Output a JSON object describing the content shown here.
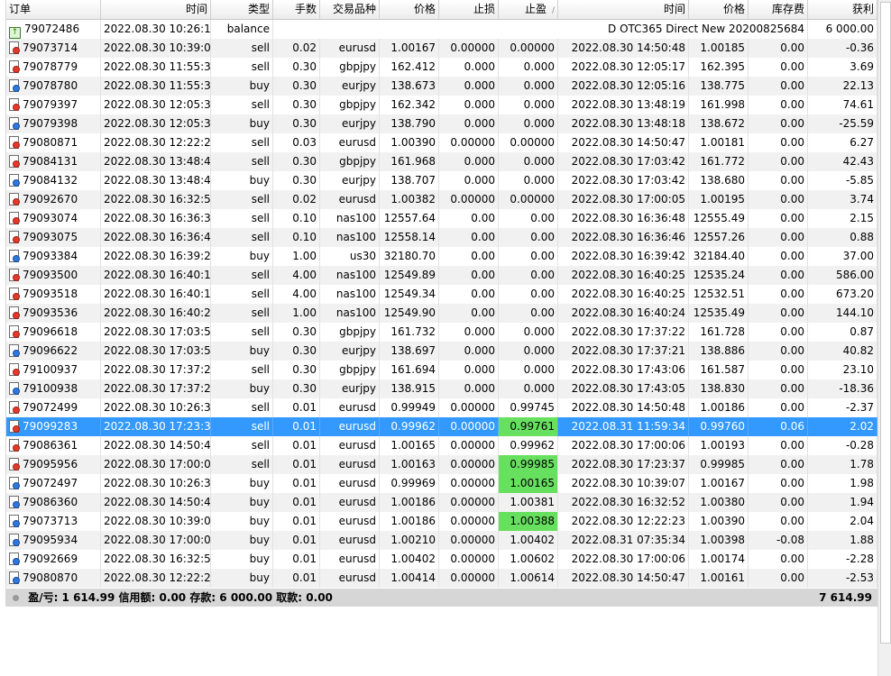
{
  "columns": [
    {
      "key": "order",
      "label": "订单",
      "align": "left"
    },
    {
      "key": "open_time",
      "label": "时间",
      "align": "right"
    },
    {
      "key": "type",
      "label": "类型",
      "align": "right"
    },
    {
      "key": "lots",
      "label": "手数",
      "align": "right"
    },
    {
      "key": "symbol",
      "label": "交易品种",
      "align": "right"
    },
    {
      "key": "open_price",
      "label": "价格",
      "align": "right"
    },
    {
      "key": "sl",
      "label": "止损",
      "align": "right"
    },
    {
      "key": "tp",
      "label": "止盈",
      "align": "right",
      "sort": "/"
    },
    {
      "key": "close_time",
      "label": "时间",
      "align": "right"
    },
    {
      "key": "close_price",
      "label": "价格",
      "align": "right"
    },
    {
      "key": "swap",
      "label": "库存费",
      "align": "right"
    },
    {
      "key": "profit",
      "label": "获利",
      "align": "right"
    }
  ],
  "balance_row": {
    "order": "79072486",
    "open_time": "2022.08.30 10:26:15",
    "type": "balance",
    "comment": "D OTC365 Direct New 20200825684",
    "profit": "6 000.00"
  },
  "rows": [
    {
      "order": "79073714",
      "open_time": "2022.08.30 10:39:08",
      "type": "sell",
      "lots": "0.02",
      "symbol": "eurusd",
      "open_price": "1.00167",
      "sl": "0.00000",
      "tp": "0.00000",
      "close_time": "2022.08.30 14:50:48",
      "close_price": "1.00185",
      "swap": "0.00",
      "profit": "-0.36"
    },
    {
      "order": "79078779",
      "open_time": "2022.08.30 11:55:37",
      "type": "sell",
      "lots": "0.30",
      "symbol": "gbpjpy",
      "open_price": "162.412",
      "sl": "0.000",
      "tp": "0.000",
      "close_time": "2022.08.30 12:05:17",
      "close_price": "162.395",
      "swap": "0.00",
      "profit": "3.69"
    },
    {
      "order": "79078780",
      "open_time": "2022.08.30 11:55:38",
      "type": "buy",
      "lots": "0.30",
      "symbol": "eurjpy",
      "open_price": "138.673",
      "sl": "0.000",
      "tp": "0.000",
      "close_time": "2022.08.30 12:05:16",
      "close_price": "138.775",
      "swap": "0.00",
      "profit": "22.13"
    },
    {
      "order": "79079397",
      "open_time": "2022.08.30 12:05:33",
      "type": "sell",
      "lots": "0.30",
      "symbol": "gbpjpy",
      "open_price": "162.342",
      "sl": "0.000",
      "tp": "0.000",
      "close_time": "2022.08.30 13:48:19",
      "close_price": "161.998",
      "swap": "0.00",
      "profit": "74.61"
    },
    {
      "order": "79079398",
      "open_time": "2022.08.30 12:05:33",
      "type": "buy",
      "lots": "0.30",
      "symbol": "eurjpy",
      "open_price": "138.790",
      "sl": "0.000",
      "tp": "0.000",
      "close_time": "2022.08.30 13:48:18",
      "close_price": "138.672",
      "swap": "0.00",
      "profit": "-25.59"
    },
    {
      "order": "79080871",
      "open_time": "2022.08.30 12:22:25",
      "type": "sell",
      "lots": "0.03",
      "symbol": "eurusd",
      "open_price": "1.00390",
      "sl": "0.00000",
      "tp": "0.00000",
      "close_time": "2022.08.30 14:50:47",
      "close_price": "1.00181",
      "swap": "0.00",
      "profit": "6.27"
    },
    {
      "order": "79084131",
      "open_time": "2022.08.30 13:48:41",
      "type": "sell",
      "lots": "0.30",
      "symbol": "gbpjpy",
      "open_price": "161.968",
      "sl": "0.000",
      "tp": "0.000",
      "close_time": "2022.08.30 17:03:42",
      "close_price": "161.772",
      "swap": "0.00",
      "profit": "42.43"
    },
    {
      "order": "79084132",
      "open_time": "2022.08.30 13:48:41",
      "type": "buy",
      "lots": "0.30",
      "symbol": "eurjpy",
      "open_price": "138.707",
      "sl": "0.000",
      "tp": "0.000",
      "close_time": "2022.08.30 17:03:42",
      "close_price": "138.680",
      "swap": "0.00",
      "profit": "-5.85"
    },
    {
      "order": "79092670",
      "open_time": "2022.08.30 16:32:53",
      "type": "sell",
      "lots": "0.02",
      "symbol": "eurusd",
      "open_price": "1.00382",
      "sl": "0.00000",
      "tp": "0.00000",
      "close_time": "2022.08.30 17:00:05",
      "close_price": "1.00195",
      "swap": "0.00",
      "profit": "3.74"
    },
    {
      "order": "79093074",
      "open_time": "2022.08.30 16:36:39",
      "type": "sell",
      "lots": "0.10",
      "symbol": "nas100",
      "open_price": "12557.64",
      "sl": "0.00",
      "tp": "0.00",
      "close_time": "2022.08.30 16:36:48",
      "close_price": "12555.49",
      "swap": "0.00",
      "profit": "2.15"
    },
    {
      "order": "79093075",
      "open_time": "2022.08.30 16:36:40",
      "type": "sell",
      "lots": "0.10",
      "symbol": "nas100",
      "open_price": "12558.14",
      "sl": "0.00",
      "tp": "0.00",
      "close_time": "2022.08.30 16:36:46",
      "close_price": "12557.26",
      "swap": "0.00",
      "profit": "0.88"
    },
    {
      "order": "79093384",
      "open_time": "2022.08.30 16:39:27",
      "type": "buy",
      "lots": "1.00",
      "symbol": "us30",
      "open_price": "32180.70",
      "sl": "0.00",
      "tp": "0.00",
      "close_time": "2022.08.30 16:39:42",
      "close_price": "32184.40",
      "swap": "0.00",
      "profit": "37.00"
    },
    {
      "order": "79093500",
      "open_time": "2022.08.30 16:40:16",
      "type": "sell",
      "lots": "4.00",
      "symbol": "nas100",
      "open_price": "12549.89",
      "sl": "0.00",
      "tp": "0.00",
      "close_time": "2022.08.30 16:40:25",
      "close_price": "12535.24",
      "swap": "0.00",
      "profit": "586.00"
    },
    {
      "order": "79093518",
      "open_time": "2022.08.30 16:40:18",
      "type": "sell",
      "lots": "4.00",
      "symbol": "nas100",
      "open_price": "12549.34",
      "sl": "0.00",
      "tp": "0.00",
      "close_time": "2022.08.30 16:40:25",
      "close_price": "12532.51",
      "swap": "0.00",
      "profit": "673.20"
    },
    {
      "order": "79093536",
      "open_time": "2022.08.30 16:40:21",
      "type": "sell",
      "lots": "1.00",
      "symbol": "nas100",
      "open_price": "12549.90",
      "sl": "0.00",
      "tp": "0.00",
      "close_time": "2022.08.30 16:40:24",
      "close_price": "12535.49",
      "swap": "0.00",
      "profit": "144.10"
    },
    {
      "order": "79096618",
      "open_time": "2022.08.30 17:03:53",
      "type": "sell",
      "lots": "0.30",
      "symbol": "gbpjpy",
      "open_price": "161.732",
      "sl": "0.000",
      "tp": "0.000",
      "close_time": "2022.08.30 17:37:22",
      "close_price": "161.728",
      "swap": "0.00",
      "profit": "0.87"
    },
    {
      "order": "79096622",
      "open_time": "2022.08.30 17:03:54",
      "type": "buy",
      "lots": "0.30",
      "symbol": "eurjpy",
      "open_price": "138.697",
      "sl": "0.000",
      "tp": "0.000",
      "close_time": "2022.08.30 17:37:21",
      "close_price": "138.886",
      "swap": "0.00",
      "profit": "40.82"
    },
    {
      "order": "79100937",
      "open_time": "2022.08.30 17:37:25",
      "type": "sell",
      "lots": "0.30",
      "symbol": "gbpjpy",
      "open_price": "161.694",
      "sl": "0.000",
      "tp": "0.000",
      "close_time": "2022.08.30 17:43:06",
      "close_price": "161.587",
      "swap": "0.00",
      "profit": "23.10"
    },
    {
      "order": "79100938",
      "open_time": "2022.08.30 17:37:26",
      "type": "buy",
      "lots": "0.30",
      "symbol": "eurjpy",
      "open_price": "138.915",
      "sl": "0.000",
      "tp": "0.000",
      "close_time": "2022.08.30 17:43:05",
      "close_price": "138.830",
      "swap": "0.00",
      "profit": "-18.36"
    },
    {
      "order": "79072499",
      "open_time": "2022.08.30 10:26:32",
      "type": "sell",
      "lots": "0.01",
      "symbol": "eurusd",
      "open_price": "0.99949",
      "sl": "0.00000",
      "tp": "0.99745",
      "close_time": "2022.08.30 14:50:48",
      "close_price": "1.00186",
      "swap": "0.00",
      "profit": "-2.37"
    },
    {
      "order": "79099283",
      "open_time": "2022.08.30 17:23:38",
      "type": "sell",
      "lots": "0.01",
      "symbol": "eurusd",
      "open_price": "0.99962",
      "sl": "0.00000",
      "tp": "0.99761",
      "tp_hit": true,
      "selected": true,
      "close_time": "2022.08.31 11:59:34",
      "close_price": "0.99760",
      "swap": "0.06",
      "profit": "2.02"
    },
    {
      "order": "79086361",
      "open_time": "2022.08.30 14:50:49",
      "type": "sell",
      "lots": "0.01",
      "symbol": "eurusd",
      "open_price": "1.00165",
      "sl": "0.00000",
      "tp": "0.99962",
      "close_time": "2022.08.30 17:00:06",
      "close_price": "1.00193",
      "swap": "0.00",
      "profit": "-0.28"
    },
    {
      "order": "79095956",
      "open_time": "2022.08.30 17:00:08",
      "type": "sell",
      "lots": "0.01",
      "symbol": "eurusd",
      "open_price": "1.00163",
      "sl": "0.00000",
      "tp": "0.99985",
      "tp_hit": true,
      "close_time": "2022.08.30 17:23:37",
      "close_price": "0.99985",
      "swap": "0.00",
      "profit": "1.78"
    },
    {
      "order": "79072497",
      "open_time": "2022.08.30 10:26:31",
      "type": "buy",
      "lots": "0.01",
      "symbol": "eurusd",
      "open_price": "0.99969",
      "sl": "0.00000",
      "tp": "1.00165",
      "tp_hit": true,
      "close_time": "2022.08.30 10:39:07",
      "close_price": "1.00167",
      "swap": "0.00",
      "profit": "1.98"
    },
    {
      "order": "79086360",
      "open_time": "2022.08.30 14:50:49",
      "type": "buy",
      "lots": "0.01",
      "symbol": "eurusd",
      "open_price": "1.00186",
      "sl": "0.00000",
      "tp": "1.00381",
      "close_time": "2022.08.30 16:32:52",
      "close_price": "1.00380",
      "swap": "0.00",
      "profit": "1.94"
    },
    {
      "order": "79073713",
      "open_time": "2022.08.30 10:39:07",
      "type": "buy",
      "lots": "0.01",
      "symbol": "eurusd",
      "open_price": "1.00186",
      "sl": "0.00000",
      "tp": "1.00388",
      "tp_hit": true,
      "close_time": "2022.08.30 12:22:23",
      "close_price": "1.00390",
      "swap": "0.00",
      "profit": "2.04"
    },
    {
      "order": "79095934",
      "open_time": "2022.08.30 17:00:07",
      "type": "buy",
      "lots": "0.01",
      "symbol": "eurusd",
      "open_price": "1.00210",
      "sl": "0.00000",
      "tp": "1.00402",
      "close_time": "2022.08.31 07:35:34",
      "close_price": "1.00398",
      "swap": "-0.08",
      "profit": "1.88"
    },
    {
      "order": "79092669",
      "open_time": "2022.08.30 16:32:53",
      "type": "buy",
      "lots": "0.01",
      "symbol": "eurusd",
      "open_price": "1.00402",
      "sl": "0.00000",
      "tp": "1.00602",
      "close_time": "2022.08.30 17:00:06",
      "close_price": "1.00174",
      "swap": "0.00",
      "profit": "-2.28"
    },
    {
      "order": "79080870",
      "open_time": "2022.08.30 12:22:24",
      "type": "buy",
      "lots": "0.01",
      "symbol": "eurusd",
      "open_price": "1.00414",
      "sl": "0.00000",
      "tp": "1.00614",
      "close_time": "2022.08.30 14:50:47",
      "close_price": "1.00161",
      "swap": "0.00",
      "profit": "-2.53"
    }
  ],
  "summary": {
    "text": "盈/亏: 1 614.99  信用额: 0.00  存款: 6 000.00  取款: 0.00",
    "total": "7 614.99"
  },
  "colors": {
    "selected": "#3399ff",
    "tp_hit": "#66e05e",
    "sell_icon": "#e43a2b",
    "buy_icon": "#2e78e0"
  },
  "icons": {
    "order_sell": "sell-order-icon",
    "order_buy": "buy-order-icon",
    "balance": "balance-icon"
  }
}
